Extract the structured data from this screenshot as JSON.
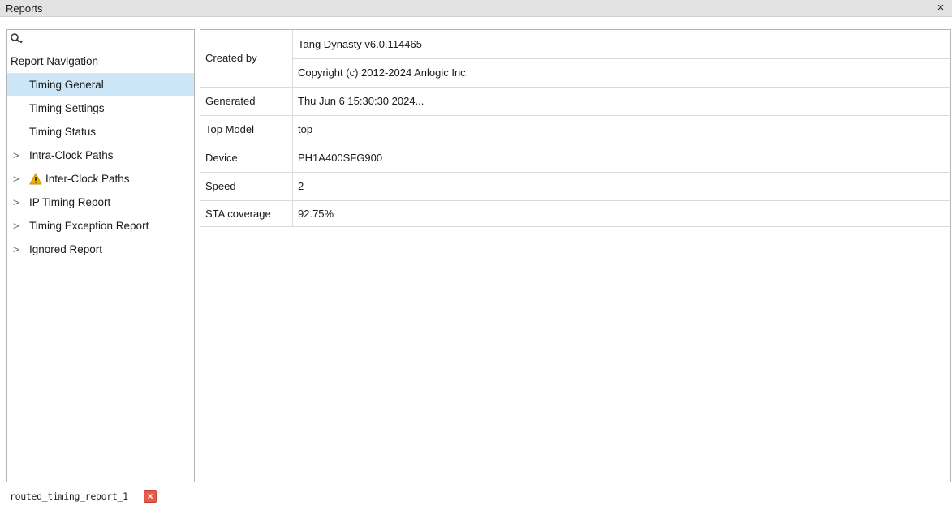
{
  "window": {
    "title": "Reports",
    "close_glyph": "×"
  },
  "search": {
    "icon": "search-icon"
  },
  "navigation": {
    "header": "Report Navigation",
    "items": [
      {
        "label": "Timing General",
        "selected": true,
        "expandable": false
      },
      {
        "label": "Timing Settings",
        "selected": false,
        "expandable": false
      },
      {
        "label": "Timing Status",
        "selected": false,
        "expandable": false
      },
      {
        "label": "Intra-Clock Paths",
        "selected": false,
        "expandable": true
      },
      {
        "label": "Inter-Clock Paths",
        "selected": false,
        "expandable": true,
        "icon": "warning-icon"
      },
      {
        "label": "IP Timing Report",
        "selected": false,
        "expandable": true
      },
      {
        "label": "Timing Exception Report",
        "selected": false,
        "expandable": true
      },
      {
        "label": "Ignored Report",
        "selected": false,
        "expandable": true
      }
    ],
    "expand_glyph": ">"
  },
  "details": {
    "created_by_label": "Created by",
    "created_by_values": [
      "Tang Dynasty v6.0.114465",
      "Copyright (c) 2012-2024 Anlogic Inc."
    ],
    "rows": [
      {
        "label": "Generated",
        "value": "Thu Jun  6 15:30:30 2024..."
      },
      {
        "label": "Top Model",
        "value": "top"
      },
      {
        "label": "Device",
        "value": "PH1A400SFG900"
      },
      {
        "label": "Speed",
        "value": "2"
      },
      {
        "label": "STA coverage",
        "value": "92.75%"
      }
    ]
  },
  "bottom_tab": {
    "label": "routed_timing_report_1",
    "close_glyph": "×"
  },
  "colors": {
    "selection": "#cde6f7",
    "titlebar": "#e3e3e3",
    "warning": "#f0b400",
    "tab_close": "#e8594a"
  }
}
